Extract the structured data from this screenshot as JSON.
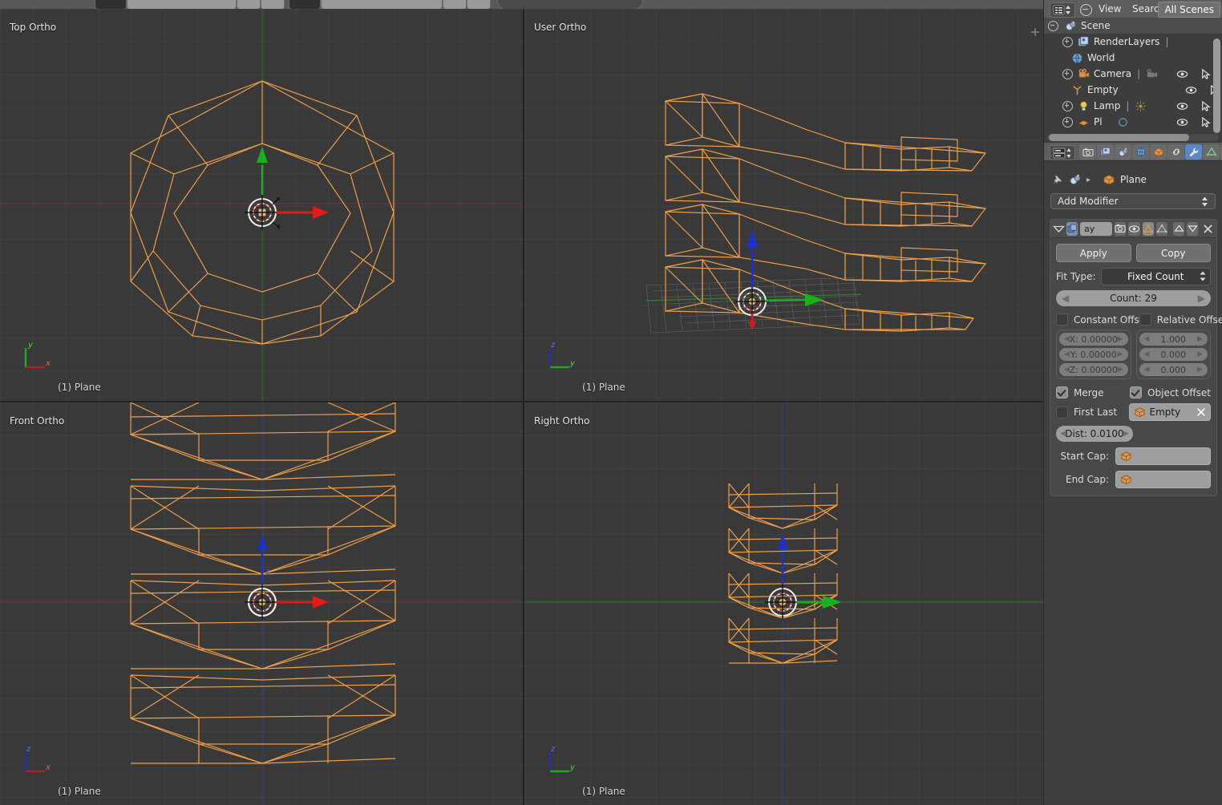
{
  "outliner": {
    "header": {
      "display_mode_icon": "outliner-display-mode-icon",
      "collapse_icon": "collapse-all-icon",
      "menus": [
        "View",
        "Search"
      ],
      "scope_selector": "All Scenes"
    },
    "rows": [
      {
        "indent": 0,
        "expander": "minus",
        "icon": "scene-icon",
        "label": "Scene",
        "selected": true,
        "extra": "",
        "toggles": false
      },
      {
        "indent": 1,
        "expander": "plus",
        "icon": "renderlayers-icon",
        "label": "RenderLayers",
        "selected": false,
        "extra": "divider",
        "toggles": false
      },
      {
        "indent": 1,
        "expander": "none",
        "icon": "world-icon",
        "label": "World",
        "selected": false,
        "extra": "",
        "toggles": false
      },
      {
        "indent": 1,
        "expander": "plus",
        "icon": "camera-icon",
        "label": "Camera",
        "selected": false,
        "extra": "camera-data-icon",
        "toggles": true
      },
      {
        "indent": 1,
        "expander": "none",
        "icon": "empty-axis-icon",
        "label": "Empty",
        "selected": false,
        "extra": "",
        "toggles": true
      },
      {
        "indent": 1,
        "expander": "plus",
        "icon": "lamp-icon",
        "label": "Lamp",
        "selected": false,
        "extra": "lamp-data-icon",
        "toggles": true
      },
      {
        "indent": 1,
        "expander": "plus",
        "icon": "mesh-icon",
        "label": "Pl",
        "selected": false,
        "extra": "mesh-data-icon",
        "toggles": true
      }
    ],
    "toggle_icons": [
      "eye-icon",
      "cursor-arrow-icon",
      "camera-render-icon"
    ]
  },
  "properties": {
    "header": {
      "editor_type_icon": "properties-editor-icon",
      "tabs": [
        {
          "name": "tab-render",
          "icon": "camera-back-icon",
          "active": false
        },
        {
          "name": "tab-render-layers",
          "icon": "images-icon",
          "active": false
        },
        {
          "name": "tab-scene",
          "icon": "scene-props-icon",
          "active": false
        },
        {
          "name": "tab-world",
          "icon": "world-globe-icon",
          "active": false
        },
        {
          "name": "tab-object",
          "icon": "orange-cube-icon",
          "active": false
        },
        {
          "name": "tab-constraints",
          "icon": "chain-link-icon",
          "active": false
        },
        {
          "name": "tab-modifiers",
          "icon": "wrench-icon",
          "active": true
        },
        {
          "name": "tab-data",
          "icon": "mesh-triangle-icon",
          "active": false
        },
        {
          "name": "tab-material",
          "icon": "material-ball-icon",
          "active": false
        }
      ]
    },
    "breadcrumb": {
      "pin_icon": "pin-icon",
      "scene_icon": "scene-icon",
      "separator": "▸",
      "object_icon": "orange-cube-icon",
      "object_name": "Plane"
    },
    "add_modifier": {
      "label": "Add Modifier",
      "arrows": "↕"
    },
    "modifier": {
      "collapse_icon": "triangle-down-icon",
      "copy_icon": "copy-icon",
      "name": "ay",
      "display_toggles": [
        {
          "name": "render-toggle-icon",
          "icon": "camera-render-icon",
          "on": false
        },
        {
          "name": "viewport-toggle-icon",
          "icon": "eye-icon",
          "on": false
        },
        {
          "name": "edit-mode-toggle-icon",
          "icon": "editmode-icon",
          "on": true
        },
        {
          "name": "cage-toggle-icon",
          "icon": "cage-icon",
          "on": false
        }
      ],
      "move_up_icon": "triangle-up-icon",
      "move_down_icon": "triangle-down-icon",
      "delete_icon": "x-close-icon",
      "apply_label": "Apply",
      "copy_label": "Copy",
      "fit_type_label": "Fit Type:",
      "fit_type_value": "Fixed Count",
      "count_field": "Count: 29",
      "constant_offset": {
        "label": "Constant Offs",
        "checked": false,
        "values": [
          "X: 0.00000",
          "Y: 0.00000",
          "Z: 0.00000"
        ]
      },
      "relative_offset": {
        "label": "Relative Offse",
        "checked": false,
        "values": [
          "1.000",
          "0.000",
          "0.000"
        ]
      },
      "merge": {
        "label": "Merge",
        "checked": true
      },
      "object_offset": {
        "label": "Object Offset",
        "checked": true
      },
      "first_last": {
        "label": "First Last",
        "checked": false
      },
      "offset_object": {
        "icon": "orange-cube-icon",
        "name": "Empty",
        "clear_icon": "x-close-icon"
      },
      "merge_dist": "Dist: 0.0100",
      "start_cap": {
        "label": "Start Cap:",
        "icon": "orange-cube-icon",
        "value": ""
      },
      "end_cap": {
        "label": "End Cap:",
        "icon": "orange-cube-icon",
        "value": ""
      }
    }
  },
  "viewports": [
    {
      "name": "viewport-top",
      "label": "Top Ortho",
      "object": "(1) Plane",
      "axes": [
        {
          "letter": "y",
          "color": "#4ac44a"
        },
        {
          "letter": "x",
          "color": "#c44040"
        }
      ]
    },
    {
      "name": "viewport-user",
      "label": "User Ortho",
      "object": "(1) Plane",
      "axes": [
        {
          "letter": "z",
          "color": "#4a5ec4"
        },
        {
          "letter": "y",
          "color": "#4ac44a"
        }
      ]
    },
    {
      "name": "viewport-front",
      "label": "Front Ortho",
      "object": "(1) Plane",
      "axes": [
        {
          "letter": "z",
          "color": "#4a5ec4"
        },
        {
          "letter": "x",
          "color": "#c44040"
        }
      ]
    },
    {
      "name": "viewport-right",
      "label": "Right Ortho",
      "object": "(1) Plane",
      "axes": [
        {
          "letter": "z",
          "color": "#4a5ec4"
        },
        {
          "letter": "y",
          "color": "#4ac44a"
        }
      ]
    }
  ],
  "colors": {
    "wireframe_selected": "#f2a04a",
    "axis_x": "#c44040",
    "axis_y": "#4ac44a",
    "axis_z": "#4a5ec4",
    "viewport_bg": "#393939",
    "panel_bg": "#3e3e3e",
    "header_bg": "#5d5d5d",
    "tab_active": "#5b87c4"
  }
}
